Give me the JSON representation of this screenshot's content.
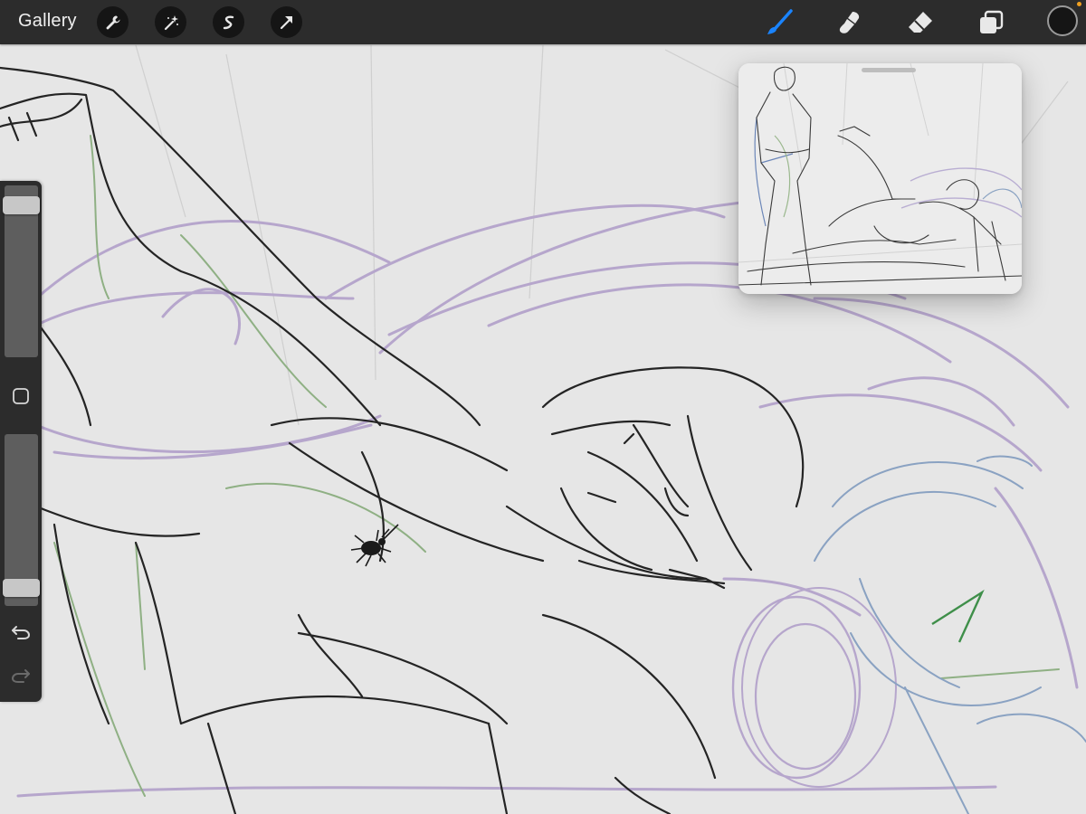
{
  "topbar": {
    "gallery_label": "Gallery",
    "left_tools": [
      "wrench-icon",
      "magic-wand-icon",
      "selection-s-icon",
      "arrow-transform-icon"
    ],
    "right_tools": [
      "brush-icon",
      "smudge-icon",
      "eraser-icon",
      "layers-icon"
    ],
    "active_tool": "brush-icon",
    "active_color": "#151515",
    "accent_color": "#1a84ff"
  },
  "sidebar": {
    "brush_size_level": 0.93,
    "opacity_level": 0.06,
    "buttons": [
      "modify-square-icon",
      "undo-icon",
      "redo-icon"
    ]
  },
  "reference_window": {
    "handle": "drag-handle"
  },
  "colors": {
    "canvas": "#e6e6e6",
    "toolbar": "#2c2c2c",
    "ink": "#242424",
    "purple_sketch": "#b6a6cc",
    "green_sketch": "#8fb084",
    "blue_sketch": "#8aa2c2"
  }
}
